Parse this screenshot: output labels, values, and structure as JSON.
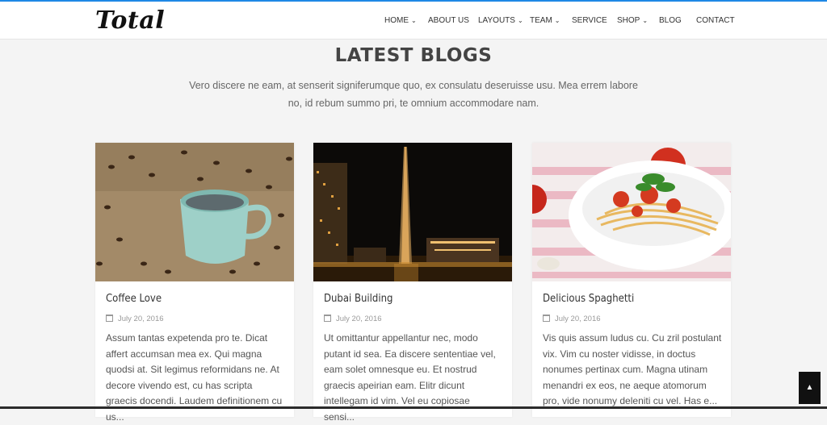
{
  "site": {
    "logo": "Total"
  },
  "nav": {
    "items": [
      {
        "label": "HOME",
        "dropdown": true
      },
      {
        "label": "ABOUT US",
        "dropdown": false
      },
      {
        "label": "LAYOUTS",
        "dropdown": true
      },
      {
        "label": "TEAM",
        "dropdown": true
      },
      {
        "label": "SERVICE",
        "dropdown": false
      },
      {
        "label": "SHOP",
        "dropdown": true
      },
      {
        "label": "BLOG",
        "dropdown": false
      },
      {
        "label": "CONTACT",
        "dropdown": false
      }
    ]
  },
  "section": {
    "title": "LATEST BLOGS",
    "description": "Vero discere ne eam, at senserit signiferumque quo, ex consulatu deseruisse usu. Mea errem labore no, id rebum summo pri, te omnium accommodare nam."
  },
  "posts": [
    {
      "title": "Coffee Love",
      "date": "July 20, 2016",
      "excerpt": "Assum tantas expetenda pro te. Dicat affert accumsan mea ex. Qui magna quodsi at. Sit legimus reformidans ne. At decore vivendo est, cu has scripta graecis docendi. Laudem definitionem cu us..."
    },
    {
      "title": "Dubai Building",
      "date": "July 20, 2016",
      "excerpt": "Ut omittantur appellantur nec, modo putant id sea. Ea discere sententiae vel, eam solet omnesque eu. Et nostrud graecis apeirian eam. Elitr dicunt intellegam id vim. Vel eu copiosae sensi..."
    },
    {
      "title": "Delicious Spaghetti",
      "date": "July 20, 2016",
      "excerpt": "Vis quis assum ludus cu. Cu zril postulant vix. Vim cu noster vidisse, in doctus nonumes pertinax cum. Magna utinam menandri ex eos, ne aeque atomorum pro, vide nonumy deleniti cu vel. Has e..."
    }
  ],
  "icons": {
    "calendar": "calendar-icon",
    "chevron": "chevron-down-icon",
    "scroll_top": "chevron-up-icon"
  },
  "colors": {
    "accent": "#1e88e5",
    "text_dark": "#333333",
    "background": "#f4f4f4"
  }
}
